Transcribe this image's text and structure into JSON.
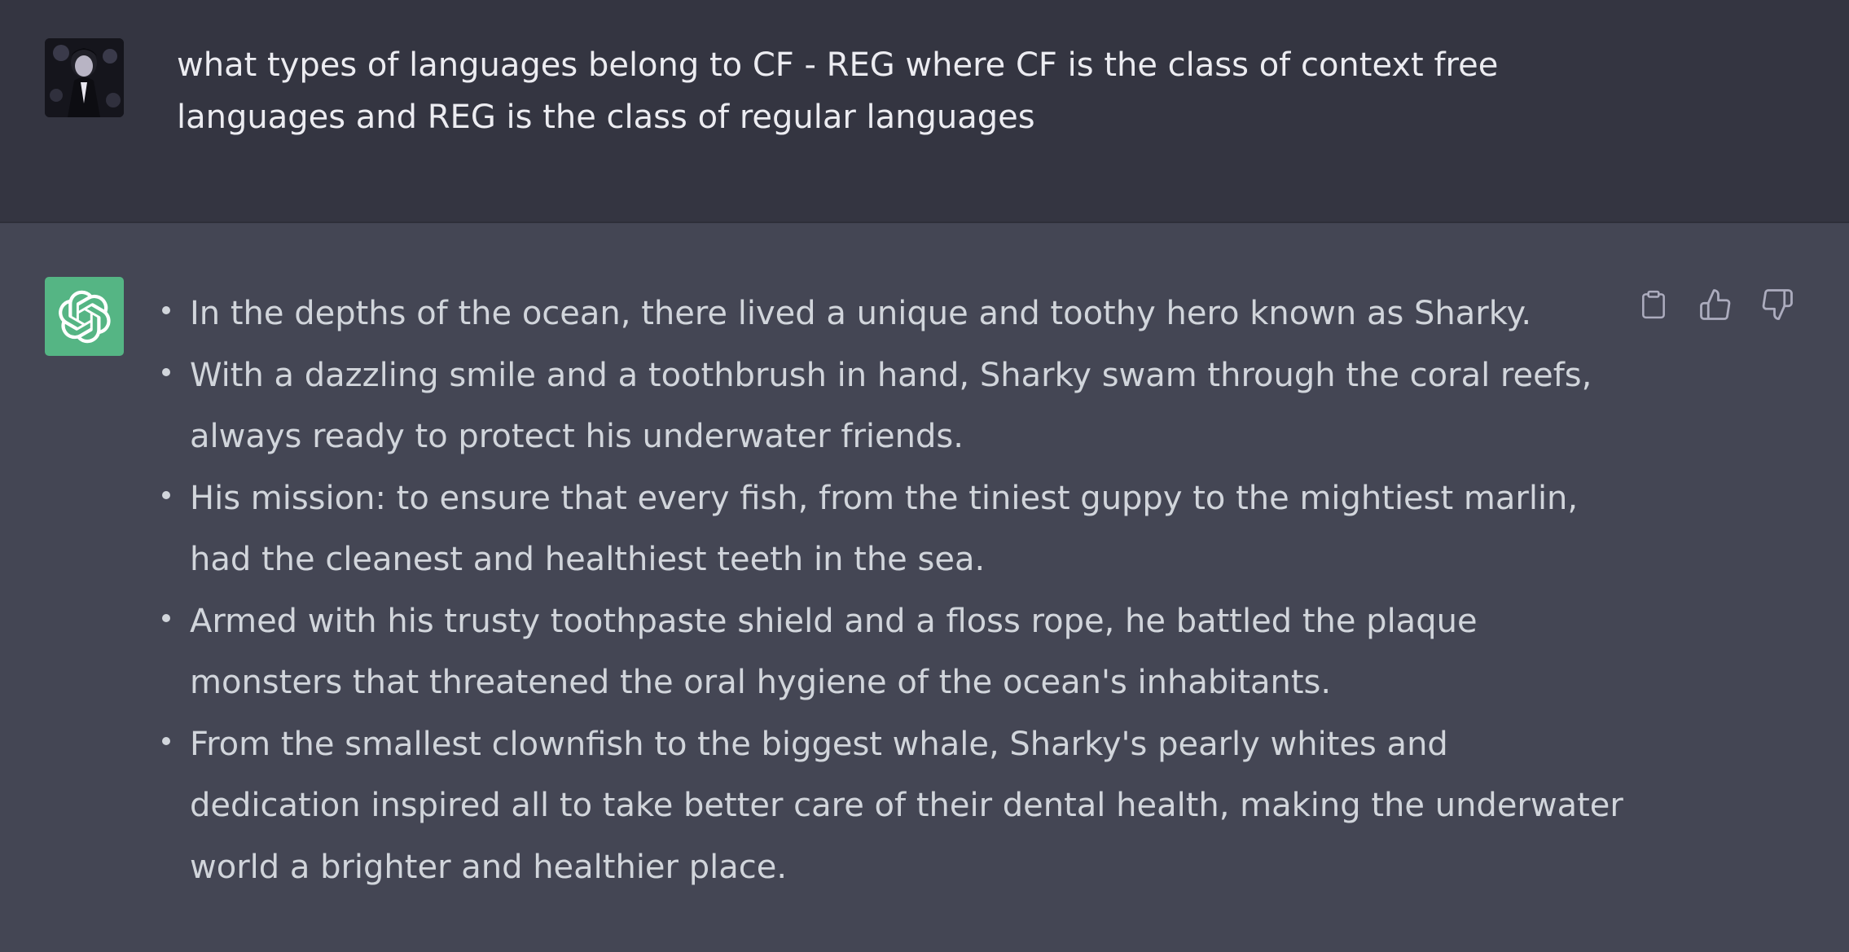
{
  "user_message": {
    "avatar_icon": "user-avatar",
    "text": "what types of languages belong to CF - REG where CF is the class of context free languages and REG is the class of regular languages"
  },
  "assistant_message": {
    "avatar_icon": "openai-logo-icon",
    "accent_color": "#55b584",
    "bullets": [
      "In the depths of the ocean, there lived a unique and toothy hero known as Sharky.",
      "With a dazzling smile and a toothbrush in hand, Sharky swam through the coral reefs, always ready to protect his underwater friends.",
      "His mission: to ensure that every fish, from the tiniest guppy to the mightiest marlin, had the cleanest and healthiest teeth in the sea.",
      "Armed with his trusty toothpaste shield and a floss rope, he battled the plaque monsters that threatened the oral hygiene of the ocean's inhabitants.",
      "From the smallest clownfish to the biggest whale, Sharky's pearly whites and dedication inspired all to take better care of their dental health, making the underwater world a brighter and healthier place."
    ],
    "actions": {
      "copy_icon": "clipboard-icon",
      "like_icon": "thumbs-up-icon",
      "dislike_icon": "thumbs-down-icon"
    }
  }
}
